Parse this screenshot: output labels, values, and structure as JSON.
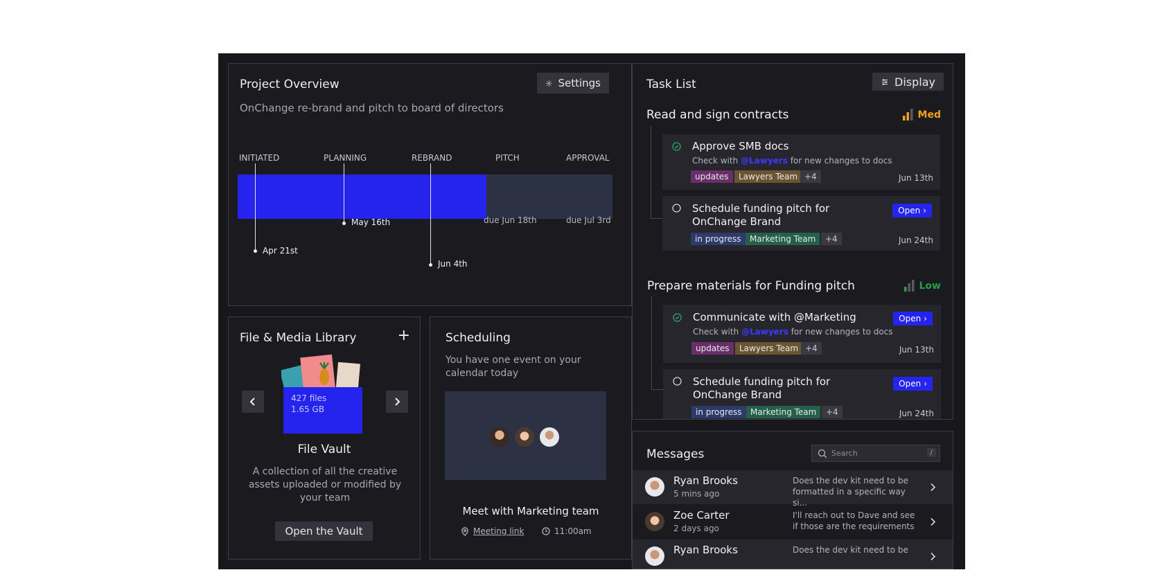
{
  "overview": {
    "title": "Project Overview",
    "settings_label": "Settings",
    "subtitle": "OnChange re-brand and pitch to board of directors",
    "phases": [
      "INITIATED",
      "PLANNING",
      "REBRAND",
      "PITCH",
      "APPROVAL"
    ],
    "progress_fraction": 0.66,
    "milestones": [
      "Apr 21st",
      "May 16th",
      "Jun 4th"
    ],
    "dues": [
      "due Jun 18th",
      "due Jul 3rd"
    ]
  },
  "tasks": {
    "title": "Task List",
    "display_label": "Display",
    "groups": [
      {
        "title": "Read and sign contracts",
        "priority": "Med",
        "items": [
          {
            "name": "Approve SMB docs",
            "sub_pre": "Check with",
            "mention": "@Lawyers",
            "sub_post": "for new changes to docs",
            "tags": [
              "updates",
              "Lawyers Team"
            ],
            "more": "+4",
            "date": "Jun 13th"
          },
          {
            "name_1": "Schedule funding pitch for",
            "name_2": "OnChange Brand",
            "open": "Open",
            "tags": [
              "in progress",
              "Marketing Team"
            ],
            "more": "+4",
            "date": "Jun 24th"
          }
        ]
      },
      {
        "title": "Prepare materials for Funding pitch",
        "priority": "Low",
        "items": [
          {
            "name": "Communicate with @Marketing",
            "open": "Open",
            "sub_pre": "Check with",
            "mention": "@Lawyers",
            "sub_post": "for new changes to docs",
            "tags": [
              "updates",
              "Lawyers Team"
            ],
            "more": "+4",
            "date": "Jun 13th"
          },
          {
            "name_1": "Schedule funding pitch for",
            "name_2": "OnChange Brand",
            "open": "Open",
            "tags": [
              "in progress",
              "Marketing Team"
            ],
            "more": "+4",
            "date": "Jun 24th"
          }
        ]
      }
    ]
  },
  "library": {
    "title": "File & Media Library",
    "files": "427 files",
    "size": "1.65 GB",
    "vault_title": "File Vault",
    "description": "A collection of all the creative assets uploaded or modified by your team",
    "open_label": "Open the Vault"
  },
  "scheduling": {
    "title": "Scheduling",
    "subtitle": "You have one event on your calendar today",
    "event": "Meet with Marketing team",
    "link": "Meeting link",
    "time": "11:00am"
  },
  "messages": {
    "title": "Messages",
    "search_placeholder": "Search",
    "shortcut": "/",
    "items": [
      {
        "name": "Ryan Brooks",
        "time": "5 mins ago",
        "text": "Does the dev kit need to be formatted in a specific way si..."
      },
      {
        "name": "Zoe Carter",
        "time": "2 days ago",
        "text": "I'll reach out to Dave and see if those are the requirements"
      },
      {
        "name": "Ryan Brooks",
        "time": "",
        "text": "Does the dev kit need to be"
      }
    ]
  },
  "colors": {
    "accent": "#2424ee",
    "med": "#f0a020",
    "low": "#22a046",
    "updates_tag": "#6a2e6a",
    "lawyers_tag": "#6a5530",
    "progress_tag": "#2e3a6a",
    "marketing_tag": "#24604a"
  }
}
